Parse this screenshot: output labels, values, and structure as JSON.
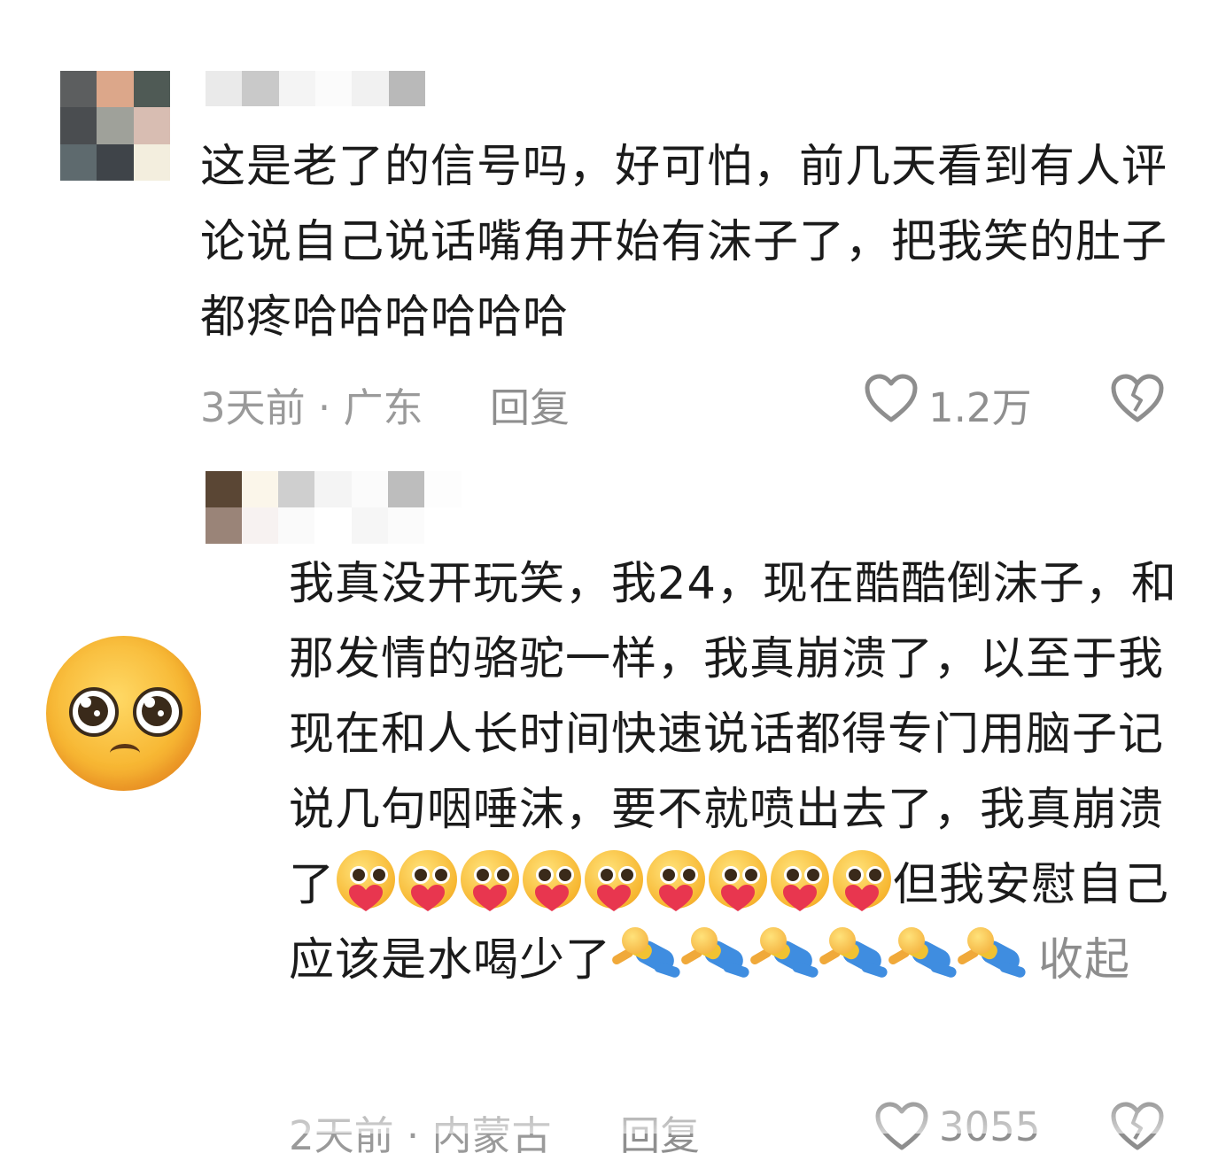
{
  "comments": [
    {
      "text": "这是老了的信号吗，好可怕，前几天看到有人评论说自己说话嘴角开始有沫子了，把我笑的肚子都疼哈哈哈哈哈哈",
      "time_location": "3天前 · 广东",
      "reply_label": "回复",
      "like_count": "1.2万"
    },
    {
      "text_part1": "我真没开玩笑，我24，现在酷酷倒沫子，和那发情的骆驼一样，我真崩溃了，以至于我现在和人长时间快速说话都得专门用脑子记说几句咽唾沫，要不就喷出去了，我真崩溃了",
      "text_part2": "但我安慰自己应该是水喝少了",
      "collapse_label": "收起",
      "time_location": "2天前 · 内蒙古",
      "reply_label": "回复",
      "like_count": "3055"
    }
  ],
  "icons": {
    "like": "heart-outline-icon",
    "dislike": "broken-heart-icon",
    "pleading": "pleading-face-emoji",
    "hearteyes": "heart-hug-emoji",
    "faint": "fainted-person-emoji"
  },
  "colors": {
    "text": "#1b1b1b",
    "meta": "#9a9a9a",
    "background": "#ffffff"
  }
}
